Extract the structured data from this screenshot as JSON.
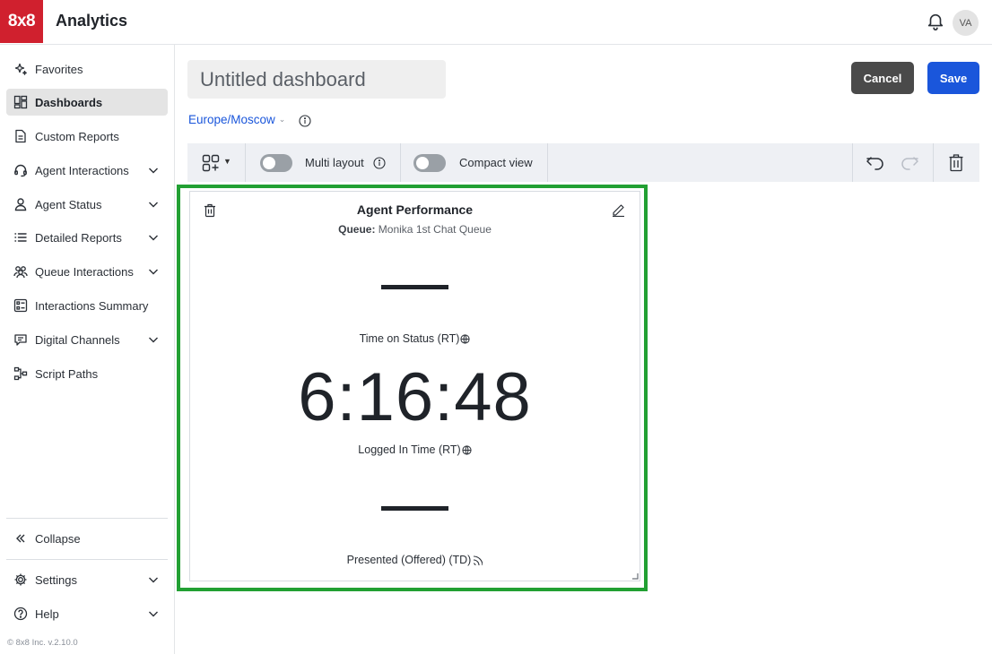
{
  "app": {
    "logo_text": "8x8",
    "title": "Analytics",
    "avatar": "VA",
    "brand_color": "#d0202e"
  },
  "sidebar": {
    "items": [
      {
        "label": "Favorites",
        "icon": "sparkle-icon"
      },
      {
        "label": "Dashboards",
        "icon": "dashboard-icon",
        "active": true
      },
      {
        "label": "Custom Reports",
        "icon": "document-icon"
      },
      {
        "label": "Agent Interactions",
        "icon": "headset-icon",
        "expandable": true
      },
      {
        "label": "Agent Status",
        "icon": "person-icon",
        "expandable": true
      },
      {
        "label": "Detailed Reports",
        "icon": "list-icon",
        "expandable": true
      },
      {
        "label": "Queue Interactions",
        "icon": "group-icon",
        "expandable": true
      },
      {
        "label": "Interactions Summary",
        "icon": "summary-icon"
      },
      {
        "label": "Digital Channels",
        "icon": "chat-icon",
        "expandable": true
      },
      {
        "label": "Script Paths",
        "icon": "flow-icon"
      }
    ],
    "collapse_label": "Collapse",
    "settings_label": "Settings",
    "help_label": "Help",
    "version": "© 8x8 Inc. v.2.10.0"
  },
  "header": {
    "dashboard_title": "Untitled dashboard",
    "cancel_label": "Cancel",
    "save_label": "Save",
    "timezone": "Europe/Moscow"
  },
  "toolbar": {
    "multi_layout_label": "Multi layout",
    "multi_layout_on": false,
    "compact_view_label": "Compact view",
    "compact_view_on": false
  },
  "widget": {
    "title": "Agent Performance",
    "queue_prefix": "Queue:",
    "queue_name": "Monika 1st Chat Queue",
    "metrics": [
      {
        "value": "—",
        "label": "Time on Status (RT)"
      },
      {
        "value": "6:16:48",
        "label": "Logged In Time (RT)"
      },
      {
        "value": "—",
        "label": "Presented (Offered) (TD)"
      }
    ]
  },
  "colors": {
    "accent": "#1a56db",
    "selection": "#22a033",
    "cancel_bg": "#4a4a4a"
  }
}
